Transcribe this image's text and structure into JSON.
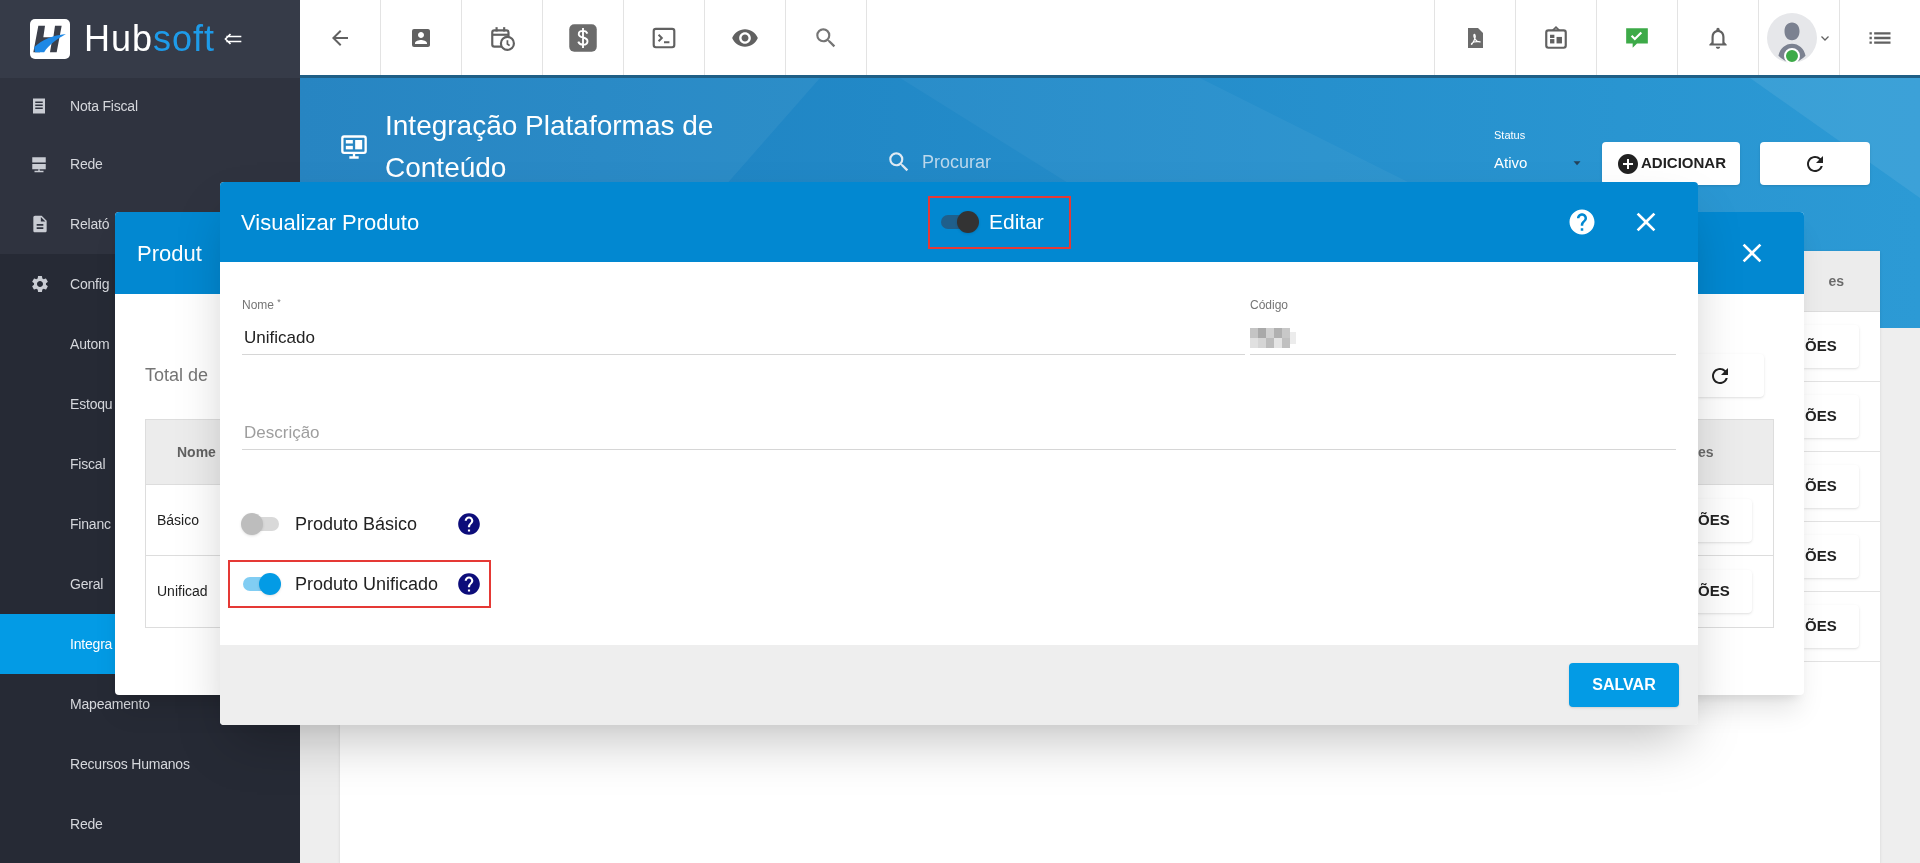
{
  "topbar": {
    "logo": [
      {
        "text": "Hub",
        "color": "#ffffff"
      },
      {
        "text": "soft",
        "color": "#1e9be9"
      }
    ],
    "user": {
      "online": true
    }
  },
  "sidebar": {
    "items": [
      {
        "label": "Nota Fiscal",
        "selected": false
      },
      {
        "label": "Rede",
        "selected": false
      },
      {
        "label": "Relató",
        "selected": false
      },
      {
        "label": "Config",
        "selected": false,
        "children": [
          {
            "label": "Autom",
            "selected": false
          },
          {
            "label": "Estoqu",
            "selected": false
          },
          {
            "label": "Fiscal",
            "selected": false
          },
          {
            "label": "Financ",
            "selected": false
          },
          {
            "label": "Geral",
            "selected": false
          },
          {
            "label": "Integra",
            "selected": true
          },
          {
            "label": "Mapeamento",
            "selected": false
          },
          {
            "label": "Recursos Humanos",
            "selected": false
          },
          {
            "label": "Rede",
            "selected": false
          }
        ]
      }
    ]
  },
  "page": {
    "title": "Integração Plataformas de Conteúdo",
    "search": {
      "placeholder": "Procurar"
    },
    "status_filter": {
      "label": "Status",
      "value": "Ativo"
    },
    "add_button": "ADICIONAR",
    "table": {
      "column_3": "es",
      "rows": [
        {
          "action": "ÕES"
        },
        {
          "action": "ÕES"
        },
        {
          "action": "ÕES"
        },
        {
          "action": "ÕES"
        },
        {
          "action": "ÕES"
        }
      ]
    }
  },
  "list_dialog": {
    "title": "Produt",
    "total_label": "Total de",
    "columns": {
      "column_1": "Nome",
      "column_3": "es"
    },
    "rows": [
      {
        "name": "Básico",
        "action": "ÕES"
      },
      {
        "name": "Unificad",
        "action": "ÕES"
      }
    ]
  },
  "product_dialog": {
    "title": "Visualizar Produto",
    "edit_toggle": {
      "label": "Editar",
      "on": true,
      "highlighted": true
    },
    "fields": [
      {
        "label": "Nome $^{*}$",
        "value": "Unificado",
        "redacted": false
      },
      {
        "label": "Código",
        "redacted": true
      }
    ],
    "description": {
      "placeholder": "Descrição"
    },
    "switches": [
      {
        "label": "Produto Básico",
        "on": false,
        "highlighted": false
      },
      {
        "label": "Produto Unificado",
        "on": true,
        "highlighted": true
      }
    ],
    "save_button": "SALVAR"
  }
}
